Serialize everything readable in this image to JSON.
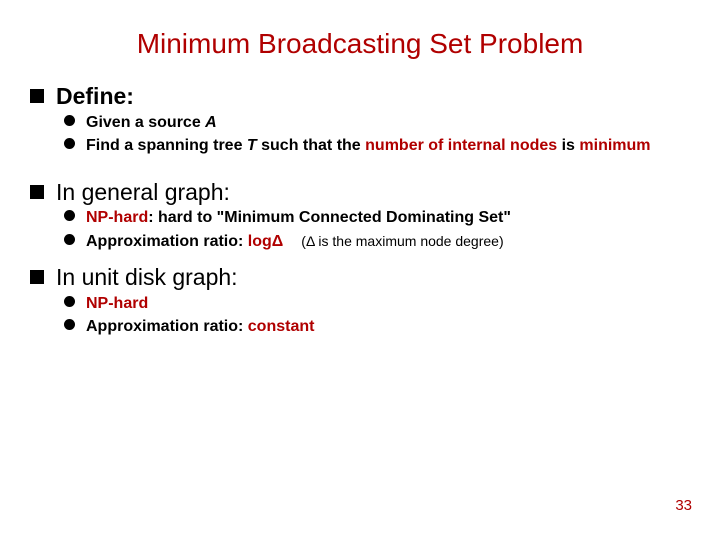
{
  "title": "Minimum Broadcasting Set Problem",
  "sections": {
    "define": {
      "heading": "Define:",
      "items": {
        "source_pre": "Given a source ",
        "source_var": "A",
        "span_pre": "Find a spanning tree ",
        "span_var": "T",
        "span_mid": " such that the ",
        "span_red1": "number of internal nodes",
        "span_post1": " is ",
        "span_red2": "minimum"
      }
    },
    "general": {
      "heading": "In general graph:",
      "np_pre": "NP-hard",
      "np_post": ": hard to \"Minimum Connected Dominating Set\"",
      "ar_label": "Approximation ratio: ",
      "ar_value": "logΔ",
      "ar_note": "(Δ is the maximum node degree)"
    },
    "udg": {
      "heading": "In unit disk graph:",
      "np": "NP-hard",
      "ar_label": "Approximation ratio: ",
      "ar_value": "constant"
    }
  },
  "page_number": "33"
}
